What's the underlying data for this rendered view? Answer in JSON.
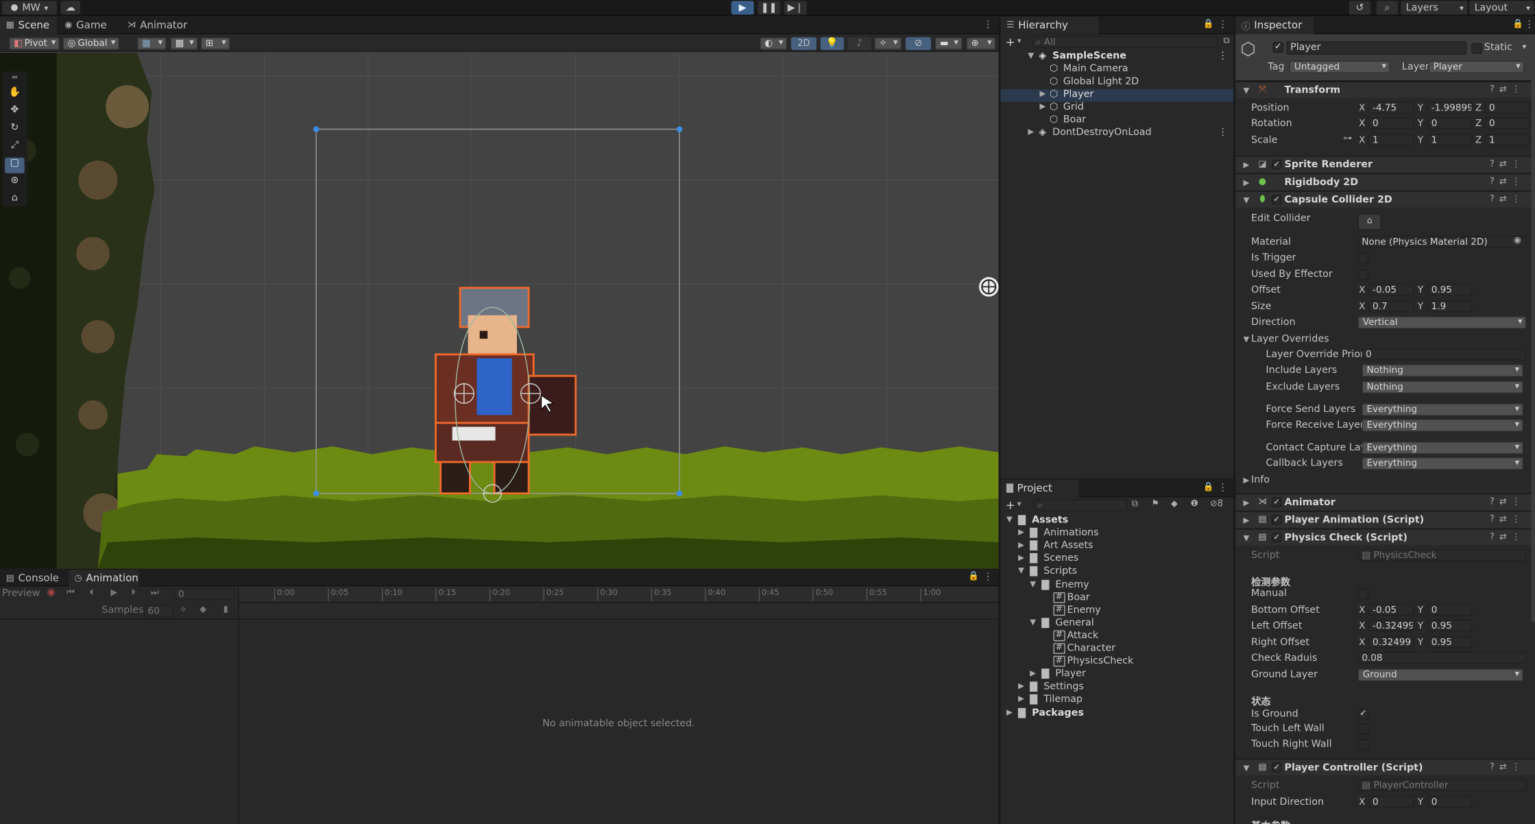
{
  "toolbar": {
    "account": "MW",
    "layers": "Layers",
    "layout": "Layout"
  },
  "scene_tabs": [
    "Scene",
    "Game",
    "Animator"
  ],
  "scene_toolbar": {
    "pivot": "Pivot",
    "global": "Global",
    "mode_2d": "2D"
  },
  "hierarchy": {
    "title": "Hierarchy",
    "search_placeholder": "All",
    "items": [
      {
        "label": "SampleScene"
      },
      {
        "label": "Main Camera"
      },
      {
        "label": "Global Light 2D"
      },
      {
        "label": "Player"
      },
      {
        "label": "Grid"
      },
      {
        "label": "Boar"
      },
      {
        "label": "DontDestroyOnLoad"
      }
    ]
  },
  "project": {
    "title": "Project",
    "hidden_count": "8",
    "items": [
      {
        "label": "Assets"
      },
      {
        "label": "Animations"
      },
      {
        "label": "Art Assets"
      },
      {
        "label": "Scenes"
      },
      {
        "label": "Scripts"
      },
      {
        "label": "Enemy"
      },
      {
        "label": "Boar"
      },
      {
        "label": "Enemy"
      },
      {
        "label": "General"
      },
      {
        "label": "Attack"
      },
      {
        "label": "Character"
      },
      {
        "label": "PhysicsCheck"
      },
      {
        "label": "Player"
      },
      {
        "label": "Settings"
      },
      {
        "label": "Tilemap"
      },
      {
        "label": "Packages"
      }
    ]
  },
  "bottom": {
    "tabs": [
      "Console",
      "Animation"
    ],
    "preview": "Preview",
    "frame": "0",
    "samples_label": "Samples",
    "samples_value": "60",
    "timeline_ticks": [
      "0:00",
      "0:05",
      "0:10",
      "0:15",
      "0:20",
      "0:25",
      "0:30",
      "0:35",
      "0:40",
      "0:45",
      "0:50",
      "0:55",
      "1:00"
    ],
    "empty_message": "No animatable object selected."
  },
  "inspector": {
    "title": "Inspector",
    "object_name": "Player",
    "static_label": "Static",
    "tag_label": "Tag",
    "tag_value": "Untagged",
    "layer_label": "Layer",
    "layer_value": "Player",
    "transform": {
      "title": "Transform",
      "position_label": "Position",
      "position": [
        "-4.75",
        "-1.99899",
        "0"
      ],
      "rotation_label": "Rotation",
      "rotation": [
        "0",
        "0",
        "0"
      ],
      "scale_label": "Scale",
      "scale": [
        "1",
        "1",
        "1"
      ]
    },
    "sprite_renderer": "Sprite Renderer",
    "rigidbody": "Rigidbody 2D",
    "capsule": {
      "title": "Capsule Collider 2D",
      "edit_collider": "Edit Collider",
      "material_label": "Material",
      "material_value": "None (Physics Material 2D)",
      "is_trigger": "Is Trigger",
      "used_by_effector": "Used By Effector",
      "offset_label": "Offset",
      "offset": [
        "-0.05",
        "0.95"
      ],
      "size_label": "Size",
      "size": [
        "0.7",
        "1.9"
      ],
      "direction_label": "Direction",
      "direction_value": "Vertical",
      "layer_overrides": "Layer Overrides",
      "override_priority_label": "Layer Override Priori",
      "override_priority": "0",
      "include_label": "Include Layers",
      "include_value": "Nothing",
      "exclude_label": "Exclude Layers",
      "exclude_value": "Nothing",
      "force_send_label": "Force Send Layers",
      "force_send_value": "Everything",
      "force_receive_label": "Force Receive Layer",
      "force_receive_value": "Everything",
      "contact_label": "Contact Capture Lay",
      "contact_value": "Everything",
      "callback_label": "Callback Layers",
      "callback_value": "Everything",
      "info": "Info"
    },
    "animator": "Animator",
    "player_animation": "Player Animation (Script)",
    "physics_check": {
      "title": "Physics Check (Script)",
      "script_label": "Script",
      "script_value": "PhysicsCheck",
      "section_params": "检测参数",
      "manual": "Manual",
      "bottom_offset_label": "Bottom Offset",
      "bottom_offset": [
        "-0.05",
        "0"
      ],
      "left_offset_label": "Left Offset",
      "left_offset": [
        "-0.32499",
        "0.95"
      ],
      "right_offset_label": "Right Offset",
      "right_offset": [
        "0.32499",
        "0.95"
      ],
      "check_radius_label": "Check Raduis",
      "check_radius": "0.08",
      "ground_layer_label": "Ground Layer",
      "ground_layer_value": "Ground",
      "section_state": "状态",
      "is_ground": "Is Ground",
      "touch_left": "Touch Left Wall",
      "touch_right": "Touch Right Wall"
    },
    "player_controller": {
      "title": "Player Controller (Script)",
      "script_label": "Script",
      "script_value": "PlayerController",
      "input_label": "Input Direction",
      "input": [
        "0",
        "0"
      ],
      "section_next": "基本参数"
    }
  },
  "axis": {
    "x": "X",
    "y": "Y",
    "z": "Z"
  }
}
